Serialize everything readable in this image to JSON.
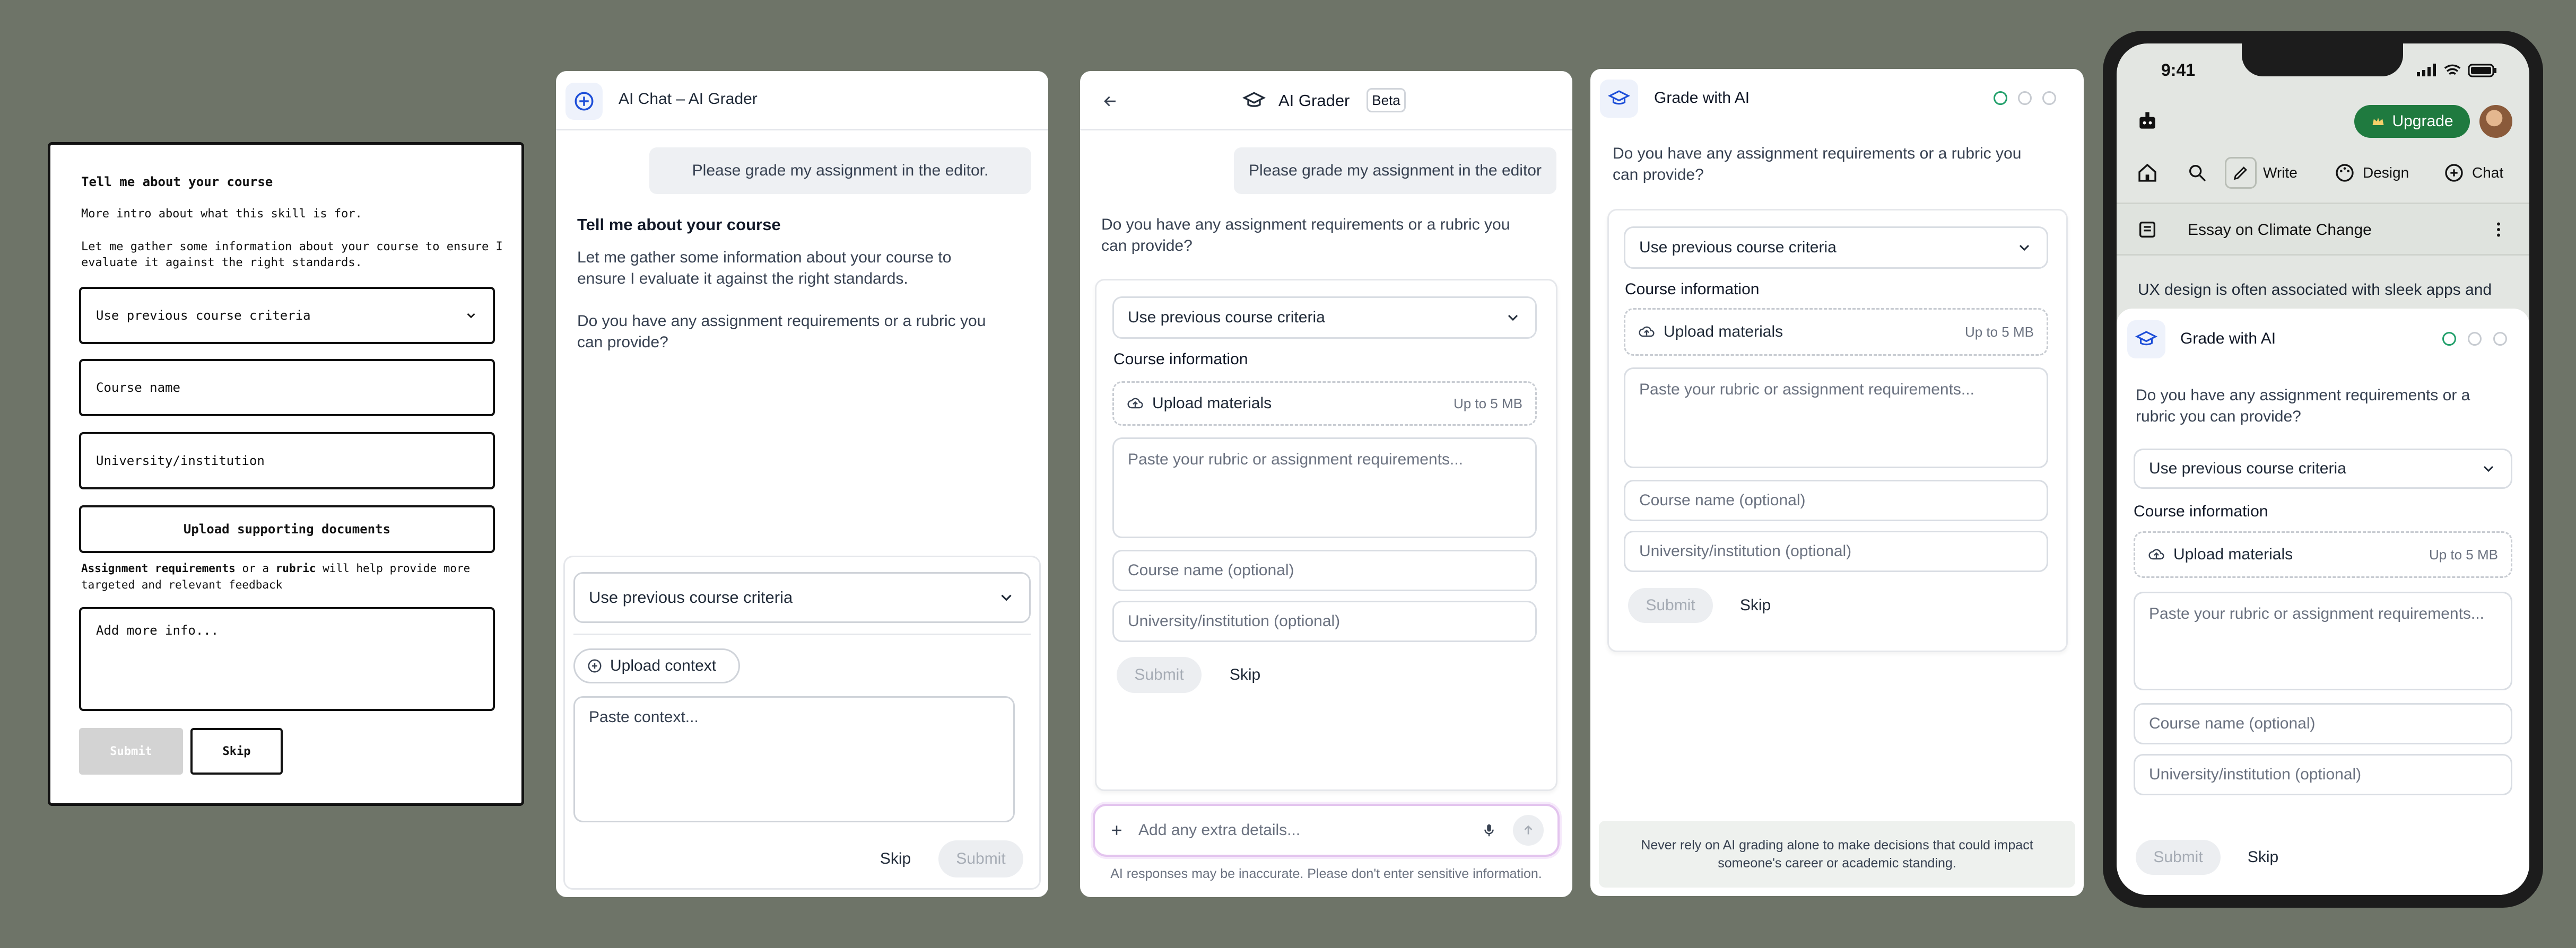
{
  "wireframe": {
    "title": "Tell me about your course",
    "intro": "More intro about what this skill is for.",
    "gather_line1": "Let me gather some information about your course to ensure I",
    "gather_line2": "evaluate it against the right standards.",
    "select": "Use previous course criteria",
    "course_name": "Course name",
    "university": "University/institution",
    "upload": "Upload supporting documents",
    "hint_bold1": "Assignment requirements",
    "hint_mid": " or a ",
    "hint_bold2": "rubric",
    "hint_end": " will help provide more",
    "hint_line2": "targeted and relevant feedback",
    "textarea": "Add more info...",
    "submit": "Submit",
    "skip": "Skip"
  },
  "chat": {
    "header_title": "AI Chat – AI Grader",
    "user_message": "Please grade my assignment in the editor.",
    "heading": "Tell me about your course",
    "para1_line1": "Let me gather some information about your course to",
    "para1_line2": "ensure I evaluate it against the right standards.",
    "para2_line1": "Do you have any assignment requirements or a rubric you",
    "para2_line2": "can provide?",
    "select": "Use previous course criteria",
    "upload_context": "Upload context",
    "paste_placeholder": "Paste context...",
    "skip": "Skip",
    "submit": "Submit"
  },
  "grader": {
    "title": "AI Grader",
    "badge": "Beta",
    "user_message": "Please grade my assignment in the editor",
    "question_line1": "Do you have any assignment requirements or a rubric you",
    "question_line2": "can provide?",
    "select": "Use previous course criteria",
    "course_info": "Course information",
    "upload": "Upload materials",
    "upload_limit": "Up to 5 MB",
    "paste_placeholder": "Paste your rubric or assignment requirements...",
    "course_name": "Course name (optional)",
    "university": "University/institution (optional)",
    "submit": "Submit",
    "skip": "Skip",
    "input_placeholder": "Add any extra details...",
    "disclaimer": "AI responses may be inaccurate. Please don't enter sensitive information."
  },
  "grade": {
    "title": "Grade with AI",
    "question_line1": "Do you have any assignment requirements or a rubric you",
    "question_line2": "can provide?",
    "select": "Use previous course criteria",
    "course_info": "Course information",
    "upload": "Upload materials",
    "upload_limit": "Up to 5 MB",
    "paste_placeholder": "Paste your rubric or assignment requirements...",
    "course_name": "Course name (optional)",
    "university": "University/institution (optional)",
    "submit": "Submit",
    "skip": "Skip",
    "footer_line1": "Never rely on AI grading alone to make decisions that could impact",
    "footer_line2": "someone's career or academic standing."
  },
  "phone": {
    "time": "9:41",
    "upgrade": "Upgrade",
    "nav_write": "Write",
    "nav_design": "Design",
    "nav_chat": "Chat",
    "doc_title": "Essay on Climate Change",
    "doc_text": "UX design is often associated with sleek apps and",
    "sheet_title": "Grade with AI",
    "question_line1": "Do you have any assignment requirements or a",
    "question_line2": "rubric you can provide?",
    "select": "Use previous course criteria",
    "course_info": "Course information",
    "upload": "Upload materials",
    "upload_limit": "Up to 5 MB",
    "paste_placeholder": "Paste your rubric or assignment requirements...",
    "course_name": "Course name (optional)",
    "university": "University/institution (optional)",
    "submit": "Submit",
    "skip": "Skip"
  },
  "colors": {
    "background": "#6e7468",
    "accent_blue": "#1d4ed8",
    "step_active": "#22a06b",
    "upgrade_green": "#1f7a3f"
  }
}
